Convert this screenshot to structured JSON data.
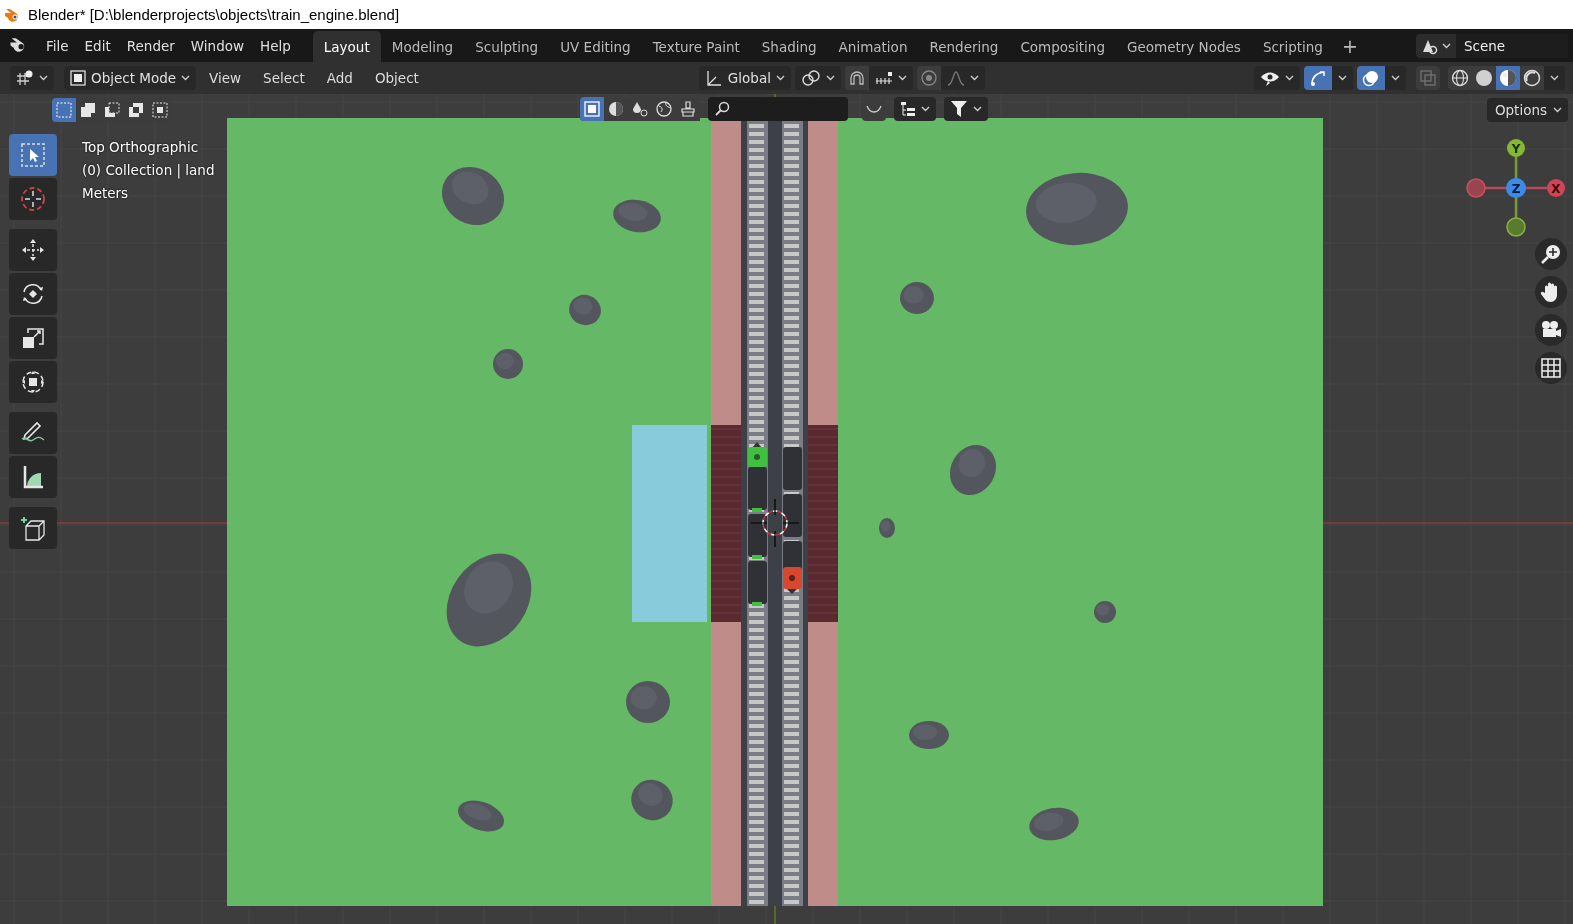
{
  "window": {
    "title": "Blender* [D:\\blenderprojects\\objects\\train_engine.blend]"
  },
  "menu": [
    "File",
    "Edit",
    "Render",
    "Window",
    "Help"
  ],
  "workspaces": [
    {
      "label": "Layout",
      "selected": true
    },
    {
      "label": "Modeling",
      "selected": false
    },
    {
      "label": "Sculpting",
      "selected": false
    },
    {
      "label": "UV Editing",
      "selected": false
    },
    {
      "label": "Texture Paint",
      "selected": false
    },
    {
      "label": "Shading",
      "selected": false
    },
    {
      "label": "Animation",
      "selected": false
    },
    {
      "label": "Rendering",
      "selected": false
    },
    {
      "label": "Compositing",
      "selected": false
    },
    {
      "label": "Geometry Nodes",
      "selected": false
    },
    {
      "label": "Scripting",
      "selected": false
    }
  ],
  "add_workspace": "+",
  "scene": {
    "name": "Scene"
  },
  "header": {
    "mode": "Object Mode",
    "menus": [
      "View",
      "Select",
      "Add",
      "Object"
    ],
    "orientation": "Global",
    "snap": {
      "on": false
    },
    "proportional_editing": {
      "on": false
    },
    "show_gizmo": {
      "on": true
    },
    "show_overlays": {
      "on": true
    },
    "xray": {
      "on": false
    },
    "shading": [
      {
        "kind": "wireframe",
        "selected": false
      },
      {
        "kind": "solid",
        "selected": false
      },
      {
        "kind": "material",
        "selected": true
      },
      {
        "kind": "rendered",
        "selected": false
      }
    ]
  },
  "select_modes": [
    {
      "kind": "set",
      "selected": true
    },
    {
      "kind": "extend",
      "selected": false
    },
    {
      "kind": "subtract",
      "selected": false
    },
    {
      "kind": "invert",
      "selected": false
    },
    {
      "kind": "intersect",
      "selected": false
    }
  ],
  "options": "Options",
  "tools": [
    {
      "kind": "select",
      "selected": true
    },
    {
      "kind": "cursor",
      "selected": false
    },
    {
      "kind": "move",
      "selected": false
    },
    {
      "kind": "rotate",
      "selected": false
    },
    {
      "kind": "scale",
      "selected": false
    },
    {
      "kind": "transform",
      "selected": false
    },
    {
      "kind": "annotate",
      "selected": false
    },
    {
      "kind": "measure",
      "selected": false
    },
    {
      "kind": "add_cube",
      "selected": false
    }
  ],
  "viewport_info": [
    "Top Orthographic",
    "(0) Collection | land",
    "Meters"
  ],
  "gizmo": {
    "y_label": "Y",
    "z_label": "Z",
    "x_label": "X"
  }
}
